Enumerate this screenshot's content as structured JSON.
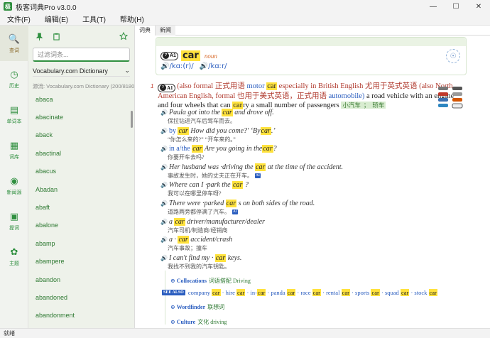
{
  "app": {
    "title": "极客词典Pro v3.0.0",
    "icon_glyph": "极",
    "brand_color": "#2f8f3f",
    "highlight_color": "#ffe23d"
  },
  "window_controls": [
    "—",
    "☐",
    "✕"
  ],
  "menubar": [
    {
      "label": "文件(F)"
    },
    {
      "label": "编辑(E)"
    },
    {
      "label": "工具(T)"
    },
    {
      "label": "帮助(H)"
    }
  ],
  "nav": [
    {
      "label": "查词",
      "icon": "search-icon",
      "glyph": "🔍",
      "active": true
    },
    {
      "label": "历史",
      "icon": "history-icon",
      "glyph": "◷",
      "active": false
    },
    {
      "label": "单词本",
      "icon": "notebook-icon",
      "glyph": "▤",
      "active": false
    },
    {
      "label": "词库",
      "icon": "wordbank-icon",
      "glyph": "▦",
      "active": false
    },
    {
      "label": "新闻源",
      "icon": "rss-icon",
      "glyph": "◉",
      "active": false
    },
    {
      "label": "提词",
      "icon": "prompt-icon",
      "glyph": "▣",
      "active": false
    },
    {
      "label": "主题",
      "icon": "palette-icon",
      "glyph": "✿",
      "active": false
    }
  ],
  "sidebar": {
    "pin_icon": "pin-icon",
    "clipboard_icon": "clipboard-icon",
    "star_icon": "star-icon",
    "filter_placeholder": "过滤词条...",
    "dictionary": "Vocabulary.com Dictionary",
    "dictionary_chevron": "⌄",
    "source_text": "源流: Vocabulary.com Dictionary (200/81808)",
    "words": [
      "abaca",
      "abacinate",
      "aback",
      "abactinal",
      "abacus",
      "Abadan",
      "abaft",
      "abalone",
      "abamp",
      "abampere",
      "abandon",
      "abandoned",
      "abandonment"
    ]
  },
  "tabs": [
    {
      "label": "词典",
      "active": true
    },
    {
      "label": "新闻",
      "active": false
    }
  ],
  "entry": {
    "level": "A1",
    "headword": "car",
    "pos": "noun",
    "pron_uk": "/kɑː(r)/",
    "pron_us": "/kɑːr/",
    "sense_number": "1",
    "sense_level": "A1",
    "definition": {
      "p1": "(also ",
      "formal": "formal",
      "formal_cn": "正式用语",
      "motor": "motor",
      "car1": "car",
      "especially": "especially in British English",
      "brit_cn": "尤用于英式英语",
      "also_na": "(also North American English,",
      "formal2": "formal",
      "amer_cn": "也用于美式英语，正式用语",
      "automobile": "automobile)",
      "p2": "a road vehicle with an engine and four wheels that can",
      "car2": "car",
      "p3": "ry a small number of passengers",
      "cn_tag1": "小汽车",
      "cn_tag2": "轿车"
    },
    "examples": [
      {
        "pre": "Paula got into the",
        "hl": "car",
        "post": "and drove off.",
        "cn": "保拉钻进汽车后驾车而去。",
        "ai": false
      },
      {
        "pre": "by",
        "hl": "car",
        "post": " How did you come?' ‘By",
        "hl2": "car",
        "post2": ".’",
        "cn": "“你怎么来的?” “开车来的。”",
        "ai": false
      },
      {
        "pre": "in a/the",
        "hl": "car",
        "post": " Are you going in the",
        "hl2": "car",
        "post2": "?",
        "cn": "你要开车去吗?",
        "ai": false
      },
      {
        "pre": "Her husband was ·driving the",
        "hl": "car",
        "post": "at the time of the accident.",
        "cn": "事故发生时，她的丈夫正在开车。",
        "ai": true
      },
      {
        "pre": "Where can I ·park the",
        "hl": "car",
        "post": "?",
        "cn": "我可以在哪里停车呀?",
        "ai": false
      },
      {
        "pre": "There were ·parked",
        "hl": "car",
        "post": "s on both sides of the road.",
        "cn": "道路两旁都停满了汽车。",
        "ai": true
      },
      {
        "pre": "a",
        "hl": "car",
        "post": "driver/manufacturer/dealer",
        "cn": "汽车司机/制造商/经销商",
        "ai": false
      },
      {
        "pre": "a ·",
        "hl": "car",
        "post": "accident/crash",
        "cn": "汽车事故；撞车",
        "ai": false
      },
      {
        "pre": "I can't find my ·",
        "hl": "car",
        "post": "keys.",
        "cn": "我找不到我的汽车钥匙。",
        "ai": false
      }
    ],
    "ai_label": "AI",
    "collocations": {
      "title": "Collocations",
      "cn": "词语搭配",
      "extra": "Driving"
    },
    "see_also": {
      "badge": "SEE ALSO",
      "items": [
        {
          "pre": "company",
          "hl": "car"
        },
        {
          "pre": "hire",
          "hl": "car"
        },
        {
          "pre": "in-",
          "hl": "car"
        },
        {
          "pre": "panda",
          "hl": "car"
        },
        {
          "pre": "race",
          "hl": "car"
        },
        {
          "pre": "rental",
          "hl": "car"
        },
        {
          "pre": "sports",
          "hl": "car"
        },
        {
          "pre": "squad",
          "hl": "car"
        },
        {
          "pre": "stock",
          "hl": "car"
        }
      ]
    },
    "wordfinder": {
      "title": "Wordfinder",
      "cn": "联想词"
    },
    "culture": {
      "title": "Culture",
      "cn": "文化",
      "extra": "driving"
    }
  },
  "status": "就绪"
}
